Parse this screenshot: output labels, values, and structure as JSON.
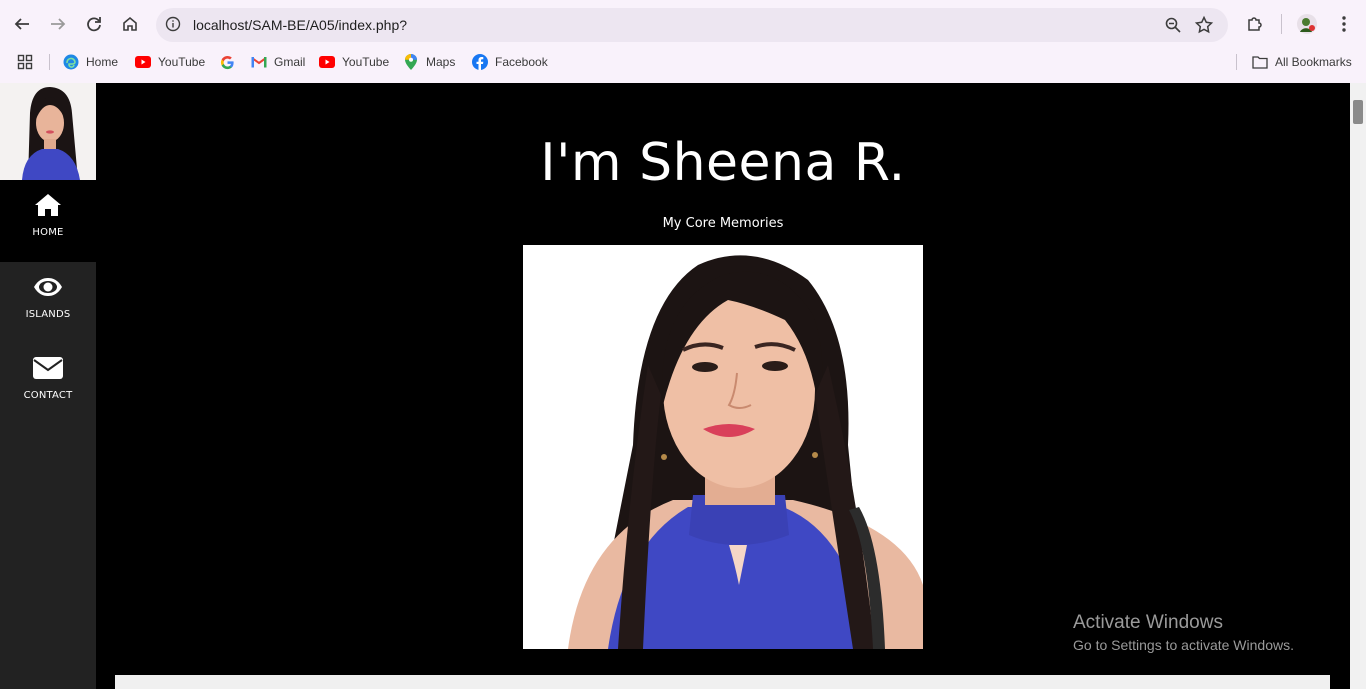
{
  "browser": {
    "url": "localhost/SAM-BE/A05/index.php?",
    "bookmarks": [
      {
        "label": "Home",
        "icon": "edge-icon"
      },
      {
        "label": "YouTube",
        "icon": "youtube-icon"
      },
      {
        "label": "",
        "icon": "google-icon"
      },
      {
        "label": "Gmail",
        "icon": "gmail-icon"
      },
      {
        "label": "YouTube",
        "icon": "youtube-icon"
      },
      {
        "label": "Maps",
        "icon": "maps-icon"
      },
      {
        "label": "Facebook",
        "icon": "facebook-icon"
      }
    ],
    "all_bookmarks": "All Bookmarks"
  },
  "sidebar": {
    "items": [
      {
        "label": "HOME",
        "icon": "home-icon",
        "active": true
      },
      {
        "label": "ISLANDS",
        "icon": "eye-icon",
        "active": false
      },
      {
        "label": "CONTACT",
        "icon": "envelope-icon",
        "active": false
      }
    ]
  },
  "hero": {
    "title": "I'm Sheena R.",
    "subtitle": "My Core Memories"
  },
  "watermark": {
    "line1": "Activate Windows",
    "line2": "Go to Settings to activate Windows."
  },
  "colors": {
    "accent_blue": "#3f48c4",
    "sidebar_bg": "#222222",
    "page_bg": "#000000"
  }
}
